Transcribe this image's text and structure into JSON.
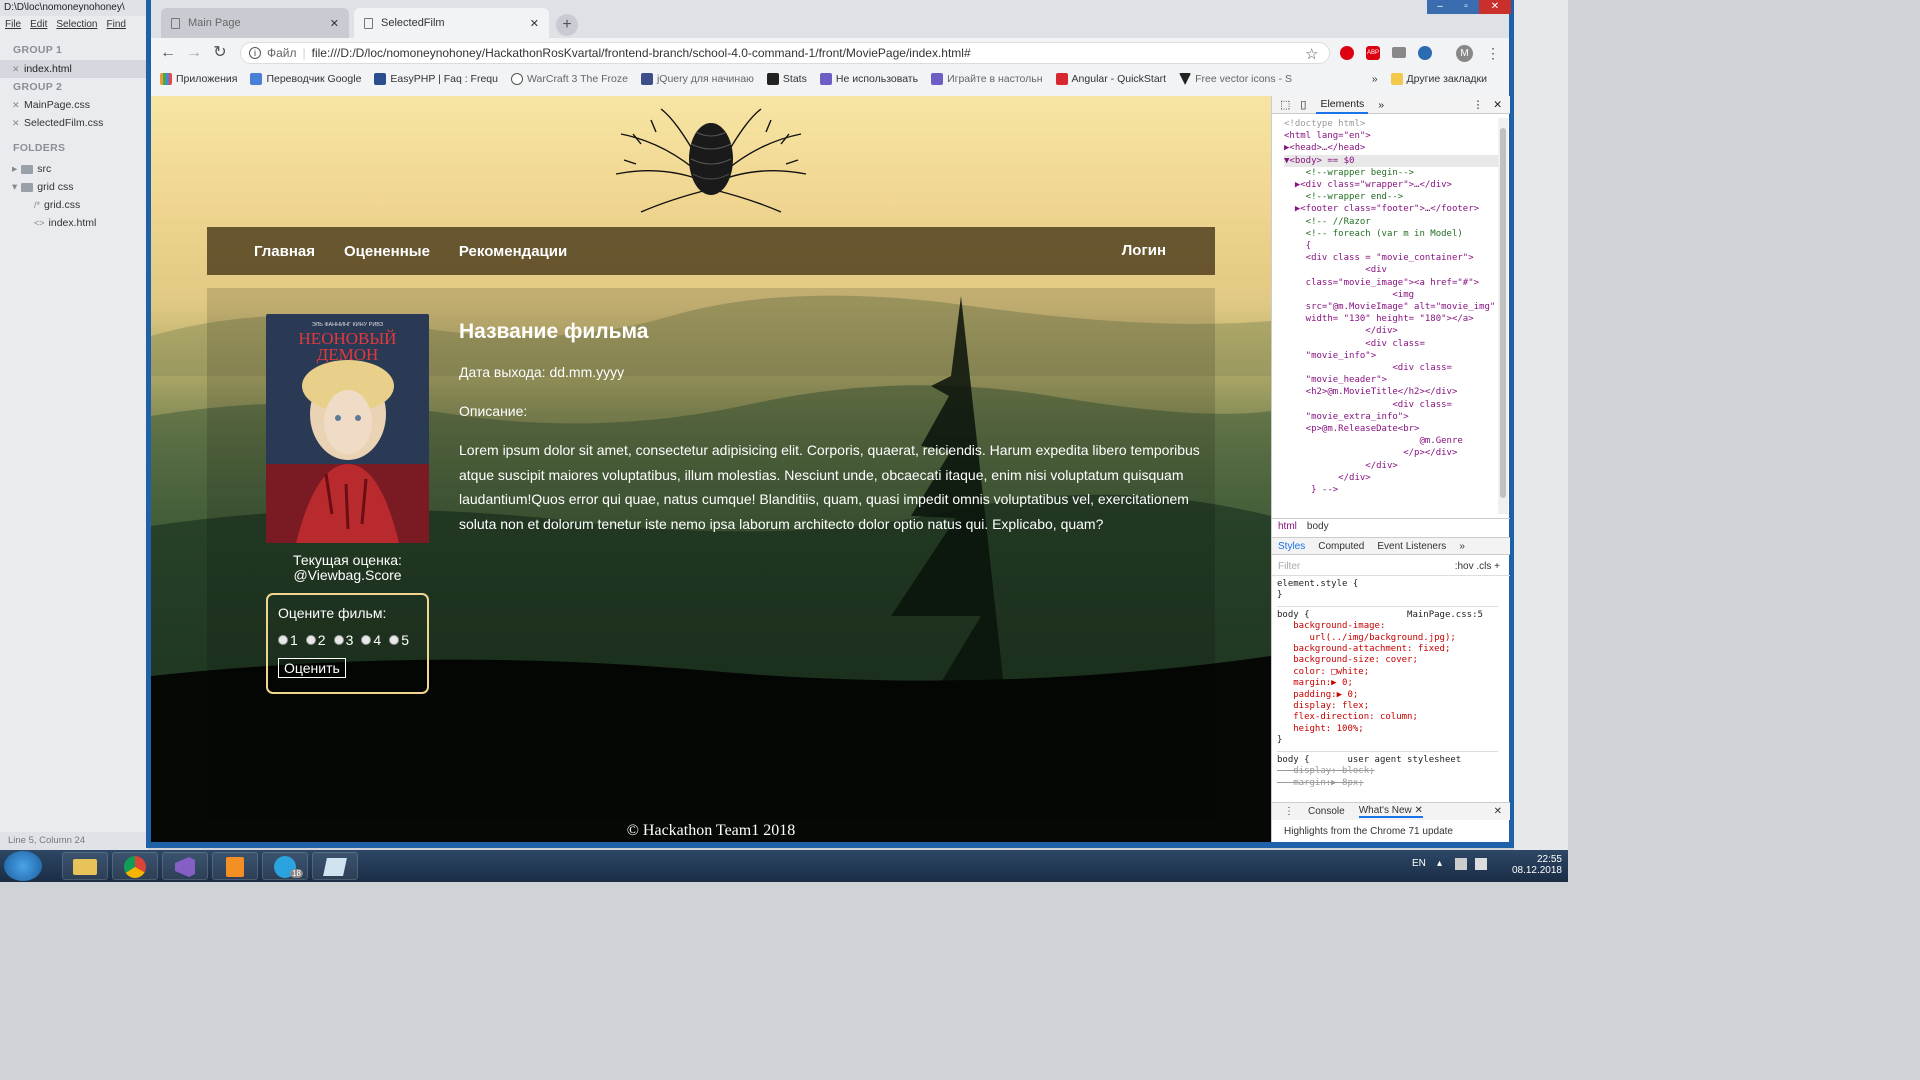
{
  "sublime": {
    "title": "D:\\D\\loc\\nomoneynohoney\\",
    "menu": [
      "File",
      "Edit",
      "Selection",
      "Find"
    ],
    "group1": "GROUP 1",
    "group1_files": [
      "index.html"
    ],
    "group2": "GROUP 2",
    "group2_files": [
      "MainPage.css",
      "SelectedFilm.css"
    ],
    "folders": "FOLDERS",
    "tree": [
      "src",
      "grid css",
      "grid.css",
      "index.html"
    ],
    "status": "Line 5, Column 24"
  },
  "browser": {
    "tabs": [
      "Main Page",
      "SelectedFilm"
    ],
    "file_label": "Файл",
    "url": "file:///D:/D/loc/nomoneynohoney/HackathonRosKvartal/frontend-branch/school-4.0-command-1/front/MoviePage/index.html#",
    "profile": "M",
    "bookmarks": [
      "Приложения",
      "Переводчик Google",
      "EasyPHP | Faq : Frequ",
      "WarCraft 3 The Froze",
      "jQuery для начинаю",
      "Stats",
      "Не использовать",
      "Играйте в настольн",
      "Angular - QuickStart",
      "Free vector icons - S"
    ],
    "bookmarks_more": "»",
    "other_bookmarks": "Другие закладки",
    "colors": {
      "page_top": "#f7e5a4",
      "page_bottom": "#000000",
      "nav_bg": "#5a4826",
      "rate_border": "#f0d690"
    }
  },
  "page": {
    "nav": [
      "Главная",
      "Оцененные",
      "Рекомендации"
    ],
    "login": "Логин",
    "poster": {
      "title_line1": "НЕОНОВЫЙ",
      "title_line2": "ДЕМОН",
      "credits": "ЭЛЬ ФАННИНГ    КИНУ РИВЗ"
    },
    "score_label": "Текущая оценка:",
    "score_value": "@Viewbag.Score",
    "rate_label": "Оцените фильм:",
    "rate_options": [
      "1",
      "2",
      "3",
      "4",
      "5"
    ],
    "rate_button": "Оценить",
    "film_title": "Название фильма",
    "release": "Дата выхода: dd.mm.yyyy",
    "desc_label": "Описание:",
    "desc_text": "Lorem ipsum dolor sit amet, consectetur adipisicing elit. Corporis, quaerat, reiciendis. Harum expedita libero temporibus atque suscipit maiores voluptatibus, illum molestias. Nesciunt unde, obcaecati itaque, enim nisi voluptatum quisquam laudantium!Quos error qui quae, natus cumque! Blanditiis, quam, quasi impedit omnis voluptatibus vel, exercitationem soluta non et dolorum tenetur iste nemo ipsa laborum architecto dolor optio natus qui. Explicabo, quam?",
    "footer": "© Hackathon Team1 2018"
  },
  "devtools": {
    "tab": "Elements",
    "dom_lines": [
      "<!doctype html>",
      "<html lang=\"en\">",
      "▶<head>…</head>",
      "▼<body> == $0",
      "    <!--wrapper begin-->",
      "  ▶<div class=\"wrapper\">…</div>",
      "    <!--wrapper end-->",
      "  ▶<footer class=\"footer\">…</footer>",
      "    <!-- //Razor",
      "",
      "    <!-- foreach (var m in Model)",
      "    {",
      "    <div class = \"movie_container\">",
      "               <div",
      "    class=\"movie_image\"><a href=\"#\">",
      "                    <img",
      "    src=\"@m.MovieImage\" alt=\"movie_img\"",
      "    width= \"130\" height= \"180\"></a>",
      "               </div>",
      "               <div class=",
      "    \"movie_info\">",
      "                    <div class=",
      "    \"movie_header\">",
      "    <h2>@m.MovieTitle</h2></div>",
      "                    <div class=",
      "    \"movie_extra_info\">",
      "    <p>@m.ReleaseDate<br>",
      "                         @m.Genre",
      "                      </p></div>",
      "               </div>",
      "          </div>",
      "     } -->"
    ],
    "crumbs": [
      "html",
      "body"
    ],
    "style_tabs": [
      "Styles",
      "Computed",
      "Event Listeners"
    ],
    "filter_placeholder": "Filter",
    "filter_tools": ":hov  .cls  +",
    "styles_lines": [
      "element.style {",
      "}",
      "body {                  MainPage.css:5",
      "   background-image:",
      "      url(../img/background.jpg);",
      "   background-attachment: fixed;",
      "   background-size: cover;",
      "   color: □white;",
      "   margin:▶ 0;",
      "   padding:▶ 0;",
      "   display: flex;",
      "   flex-direction: column;",
      "   height: 100%;",
      "}",
      "body {       user agent stylesheet",
      "   display: block;",
      "   margin:▶ 8px;"
    ],
    "console_tabs": [
      "Console",
      "What's New"
    ],
    "console_msg": "Highlights from the Chrome 71 update"
  },
  "taskbar": {
    "lang": "EN",
    "time": "22:55",
    "date": "08.12.2018",
    "telegram_badge": "18"
  }
}
